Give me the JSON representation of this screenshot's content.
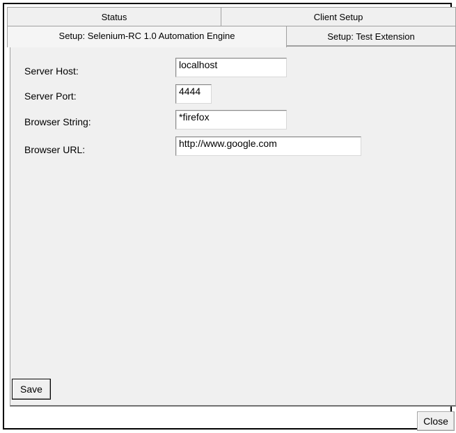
{
  "tabs": {
    "row1": [
      "Status",
      "Client Setup"
    ],
    "row2": [
      "Setup: Selenium-RC 1.0 Automation Engine",
      "Setup: Test Extension"
    ],
    "selected": "Setup: Selenium-RC 1.0 Automation Engine"
  },
  "form": {
    "server_host": {
      "label": "Server Host:",
      "value": "localhost"
    },
    "server_port": {
      "label": "Server Port:",
      "value": "4444"
    },
    "browser_string": {
      "label": "Browser String:",
      "value": "*firefox"
    },
    "browser_url": {
      "label": "Browser URL:",
      "value": "http://www.google.com"
    }
  },
  "buttons": {
    "save": "Save",
    "close": "Close"
  }
}
